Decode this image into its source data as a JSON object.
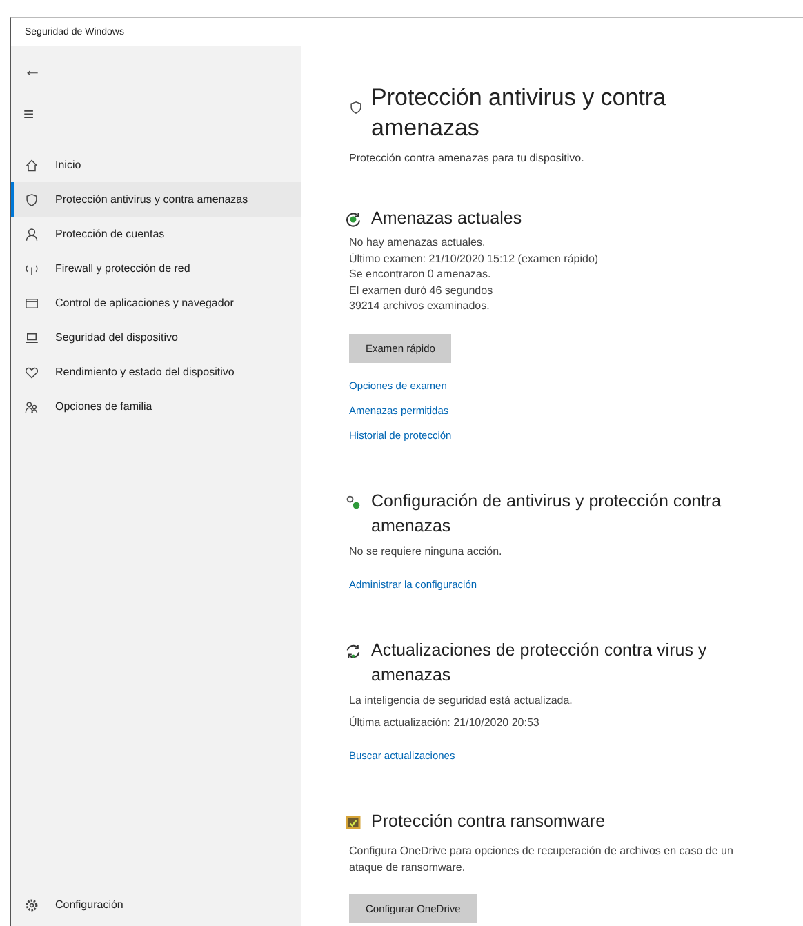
{
  "window": {
    "title": "Seguridad de Windows"
  },
  "sidebar": {
    "back": "←",
    "menu": "≡",
    "items": [
      {
        "kind": "home",
        "label": "Inicio",
        "selected": false
      },
      {
        "kind": "shield",
        "label": "Protección antivirus y contra amenazas",
        "selected": true
      },
      {
        "kind": "person",
        "label": "Protección de cuentas",
        "selected": false
      },
      {
        "kind": "wifi",
        "label": "Firewall y protección de red",
        "selected": false
      },
      {
        "kind": "browser",
        "label": "Control de aplicaciones y navegador",
        "selected": false
      },
      {
        "kind": "laptop",
        "label": "Seguridad del dispositivo",
        "selected": false
      },
      {
        "kind": "heart",
        "label": "Rendimiento y estado del dispositivo",
        "selected": false
      },
      {
        "kind": "family",
        "label": "Opciones de familia",
        "selected": false
      }
    ],
    "footer": {
      "kind": "gear",
      "label": "Configuración"
    }
  },
  "page": {
    "title": "Protección antivirus y contra amenazas",
    "subtitle": "Protección contra amenazas para tu dispositivo.",
    "sections": [
      {
        "kind": "scan",
        "heading": "Amenazas actuales",
        "lines": [
          "No hay amenazas actuales.",
          "Último examen: 21/10/2020 15:12 (examen rápido)",
          "Se encontraron 0 amenazas.",
          "El examen duró 46 segundos",
          "39214 archivos examinados."
        ],
        "button": "Examen rápido",
        "links": [
          "Opciones de examen",
          "Amenazas permitidas",
          "Historial de protección"
        ]
      },
      {
        "kind": "gears",
        "heading": "Configuración de antivirus y protección contra amenazas",
        "lines": [
          "No se requiere ninguna acción."
        ],
        "links": [
          "Administrar la configuración"
        ]
      },
      {
        "kind": "refresh",
        "heading": "Actualizaciones de protección contra virus y amenazas",
        "lines": [
          "La inteligencia de seguridad está actualizada.",
          "Última actualización: 21/10/2020 20:53"
        ],
        "links": [
          "Buscar actualizaciones"
        ]
      },
      {
        "kind": "folder",
        "heading": "Protección contra ransomware",
        "lines": [
          "Configura OneDrive para opciones de recuperación de archivos en caso de un ataque de ransomware."
        ],
        "button": "Configurar OneDrive"
      }
    ]
  }
}
